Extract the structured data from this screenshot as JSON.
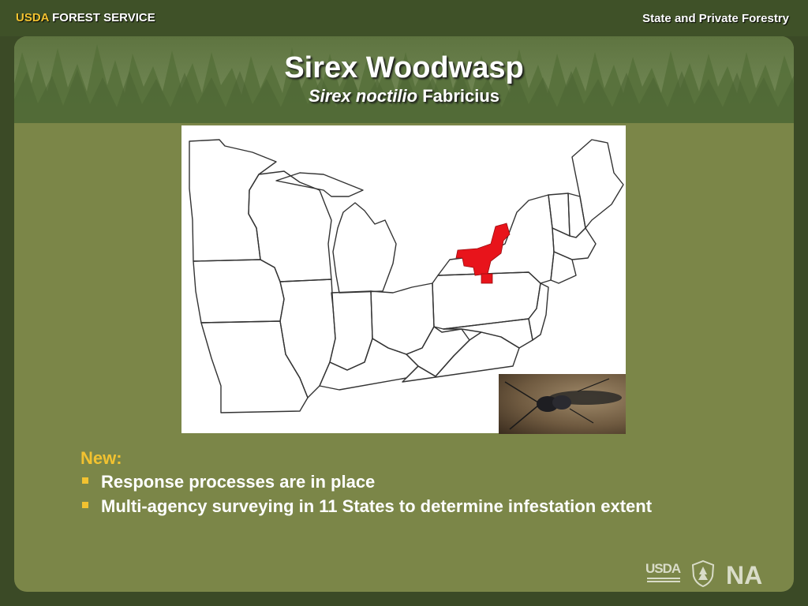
{
  "header": {
    "brand_usda": "USDA",
    "brand_rest": " FOREST SERVICE",
    "right_text": "State and Private Forestry"
  },
  "slide": {
    "title": "Sirex Woodwasp",
    "subtitle_italic": "Sirex noctilio",
    "subtitle_rest": " Fabricius"
  },
  "content": {
    "heading": "New:",
    "bullets": [
      "Response processes are in place",
      "Multi-agency surveying in 11 States to determine infestation extent"
    ]
  },
  "footer": {
    "logo_usda": "USDA",
    "logo_na": "NA"
  },
  "colors": {
    "accent": "#f2c230",
    "panel": "#7b8648",
    "infestation": "#e8141b"
  }
}
